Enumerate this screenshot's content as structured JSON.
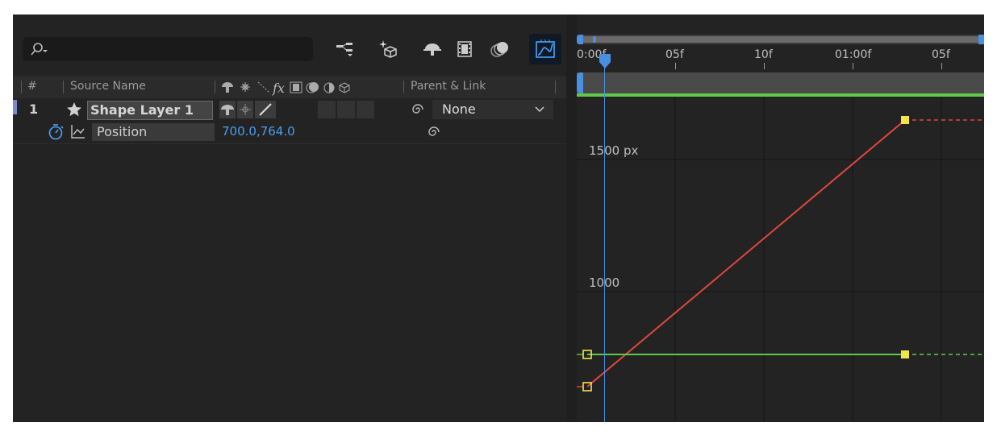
{
  "search": {
    "placeholder": ""
  },
  "columns": {
    "num": "#",
    "source_name": "Source Name",
    "parent_link": "Parent & Link"
  },
  "layer": {
    "number": "1",
    "name": "Shape Layer 1",
    "parent": "None"
  },
  "property": {
    "name": "Position",
    "value": "700.0,764.0"
  },
  "timeline": {
    "ruler_labels": [
      "0:00f",
      "05f",
      "10f",
      "01:00f",
      "05f"
    ],
    "value_labels": [
      "1500 px",
      "1000"
    ]
  },
  "colors": {
    "accent_blue": "#4a90e2",
    "curve_red": "#e0473c",
    "curve_green": "#5ec94a",
    "keyframe_yellow": "#f5e54a",
    "bg_dark": "#232323"
  },
  "icons": [
    "search-icon",
    "flowchart-icon",
    "draft-3d-icon",
    "solo-icon",
    "motion-blur-icon",
    "shy-icon",
    "graph-editor-icon",
    "stopwatch-icon",
    "graph-icon",
    "pickwhip-icon",
    "star-icon"
  ]
}
